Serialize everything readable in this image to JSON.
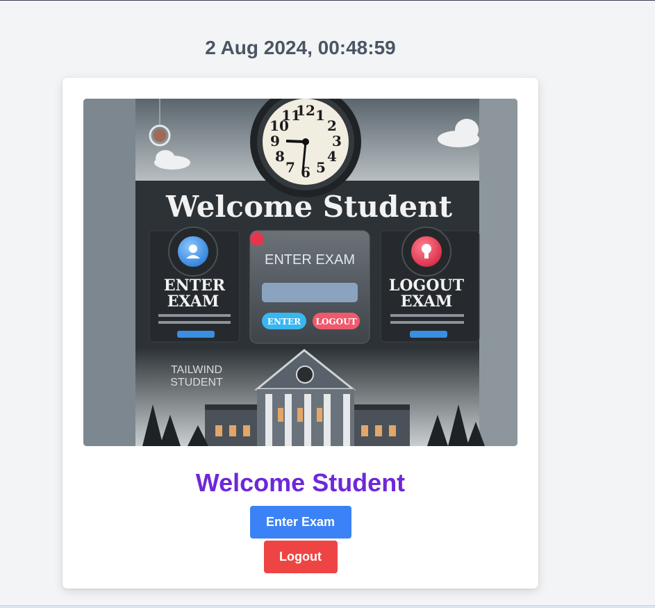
{
  "header": {
    "datetime": "2 Aug 2024, 00:48:59"
  },
  "hero_image": {
    "headline": "Welcome Student",
    "left_panel": {
      "line1": "ENTER",
      "line2": "EXAM"
    },
    "center_panel": {
      "title": "ENTER EXAM",
      "enter_label": "ENTER",
      "logout_label": "LOGOUT"
    },
    "right_panel": {
      "line1": "LOGOUT",
      "line2": "EXAM"
    },
    "brand": {
      "line1": "TAILWIND",
      "line2": "STUDENT"
    },
    "clock_numbers": [
      "12",
      "1",
      "2",
      "3",
      "4",
      "5",
      "6",
      "7",
      "8",
      "9",
      "10",
      "11"
    ]
  },
  "card": {
    "title": "Welcome Student",
    "enter_button": "Enter Exam",
    "logout_button": "Logout"
  },
  "colors": {
    "title": "#6d28d9",
    "enter_button": "#3b82f6",
    "logout_button": "#ef4444",
    "datetime": "#4b5563"
  }
}
